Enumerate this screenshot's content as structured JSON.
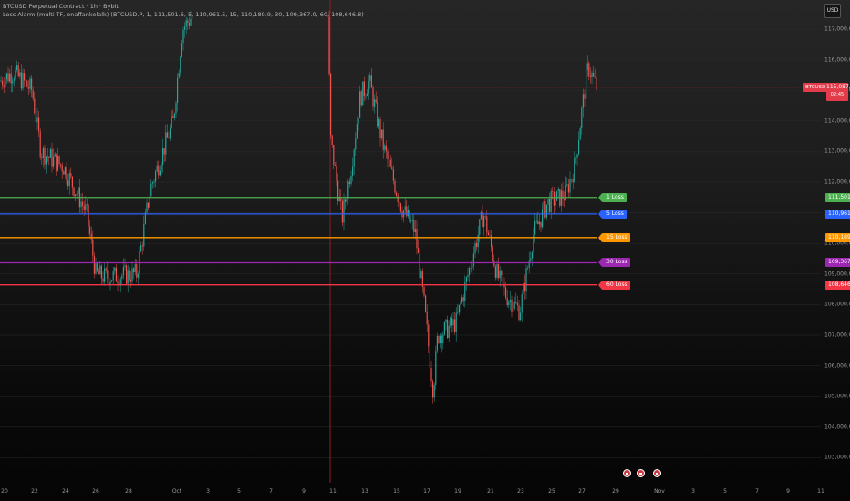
{
  "header": {
    "title": "BTCUSD Perpetual Contract · 1h · Bybit",
    "indicator": "Loss Alarm (multi-TF, onaffankelalk) (BTCUSD.P, 1, 111,501.6, 5, 110,961.5, 15, 110,189.9, 30, 109,367.0, 60, 108,646.8)"
  },
  "currency": "USD",
  "current_price": {
    "symbol": "BTCUSD.P",
    "price": "115,087.5",
    "countdown": "02:45",
    "color": "#e23b4a"
  },
  "y_axis": [
    "117,000.0",
    "116,000.0",
    "115,000.0",
    "114,000.0",
    "113,000.0",
    "112,000.0",
    "111,000.0",
    "110,000.0",
    "109,000.0",
    "108,000.0",
    "107,000.0",
    "106,000.0",
    "105,000.0",
    "104,000.0",
    "103,000.0"
  ],
  "x_axis": [
    "20",
    "22",
    "24",
    "26",
    "28",
    "Oct",
    "3",
    "5",
    "7",
    "9",
    "11",
    "13",
    "15",
    "17",
    "19",
    "21",
    "23",
    "25",
    "27",
    "29",
    "Nov",
    "3",
    "5",
    "7",
    "9",
    "11"
  ],
  "levels": [
    {
      "label": "1 Loss",
      "price": "111,501.6",
      "value": 111501.6,
      "color": "#4caf50"
    },
    {
      "label": "5 Loss",
      "price": "110,961.5",
      "value": 110961.5,
      "color": "#2962ff"
    },
    {
      "label": "15 Loss",
      "price": "110,189.9",
      "value": 110189.9,
      "color": "#ff9800"
    },
    {
      "label": "30 Loss",
      "price": "109,367.0",
      "value": 109367.0,
      "color": "#9c27b0"
    },
    {
      "label": "60 Loss",
      "price": "108,646.8",
      "value": 108646.8,
      "color": "#f23645"
    }
  ],
  "colors": {
    "up": "#26a69a",
    "down": "#ef5350",
    "session_line": "#8b1e25",
    "price_line": "#7a2328"
  },
  "event_icons": [
    "flag-icon",
    "flag-icon",
    "flag-icon"
  ]
}
